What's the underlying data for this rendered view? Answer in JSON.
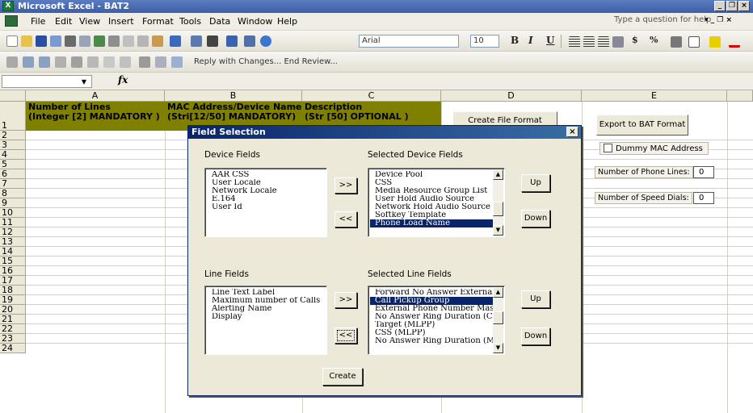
{
  "window": {
    "title": "Microsoft Excel - BAT2",
    "app_icon_glyph": "X",
    "buttons": [
      "_",
      "❐",
      "×"
    ]
  },
  "menu": {
    "items": [
      "File",
      "Edit",
      "View",
      "Insert",
      "Format",
      "Tools",
      "Data",
      "Window",
      "Help"
    ],
    "help_placeholder": "Type a question for help",
    "doc_controls": "▾ _ ❐ ×"
  },
  "toolbar": {
    "font_name": "Arial",
    "font_size": "10",
    "bold": "B",
    "italic": "I",
    "underline": "U",
    "currency": "$",
    "percent": "%",
    "review_text": "Reply with Changes...   End Review..."
  },
  "formula_bar": {
    "name_box": "",
    "fx": "fx"
  },
  "sheet": {
    "columns": [
      "A",
      "B",
      "C",
      "D",
      "E"
    ],
    "rows": [
      "1",
      "2",
      "3",
      "4",
      "5",
      "6",
      "7",
      "8",
      "9",
      "10",
      "11",
      "12",
      "13",
      "14",
      "15",
      "16",
      "17",
      "18",
      "19",
      "20",
      "21",
      "22",
      "23",
      "24"
    ],
    "header_a": "Number of Lines\n(Integer [2] MANDATORY )",
    "header_b": "MAC Address/Device Name\n(Stri[12/50] MANDATORY)",
    "header_c": "Description\n(Str [50] OPTIONAL )",
    "create_file_format": "Create File Format",
    "export_bat": "Export to BAT Format",
    "dummy_mac": "Dummy MAC Address",
    "phone_lines_label": "Number of Phone Lines:",
    "phone_lines_value": "0",
    "speed_dials_label": "Number of Speed Dials:",
    "speed_dials_value": "0"
  },
  "dialog": {
    "title": "Field Selection",
    "close": "×",
    "device_fields_label": "Device Fields",
    "device_fields": [
      "AAR CSS",
      "User Locale",
      "Network Locale",
      "E.164",
      "User Id"
    ],
    "selected_device_label": "Selected Device Fields",
    "selected_device_fields": [
      "Device Pool",
      "CSS",
      "Media Resource Group List",
      "User Hold Audio Source",
      "Network Hold Audio Source",
      "Softkey Template",
      "Phone Load Name"
    ],
    "selected_device_index": 6,
    "line_fields_label": "Line Fields",
    "line_fields": [
      "Line Text Label",
      "Maximum number of Calls",
      "Alerting Name",
      "Display"
    ],
    "selected_line_label": "Selected Line Fields",
    "selected_line_fields": [
      "Forward No Answer External",
      "Call Pickup Group",
      "External Phone Number Mask",
      "No Answer Ring Duration (CFwd)",
      "Target (MLPP)",
      "CSS (MLPP)",
      "No Answer Ring Duration (MLPP)"
    ],
    "selected_line_index": 1,
    "add": ">>",
    "remove": "<<",
    "up": "Up",
    "down": "Down",
    "create": "Create"
  }
}
